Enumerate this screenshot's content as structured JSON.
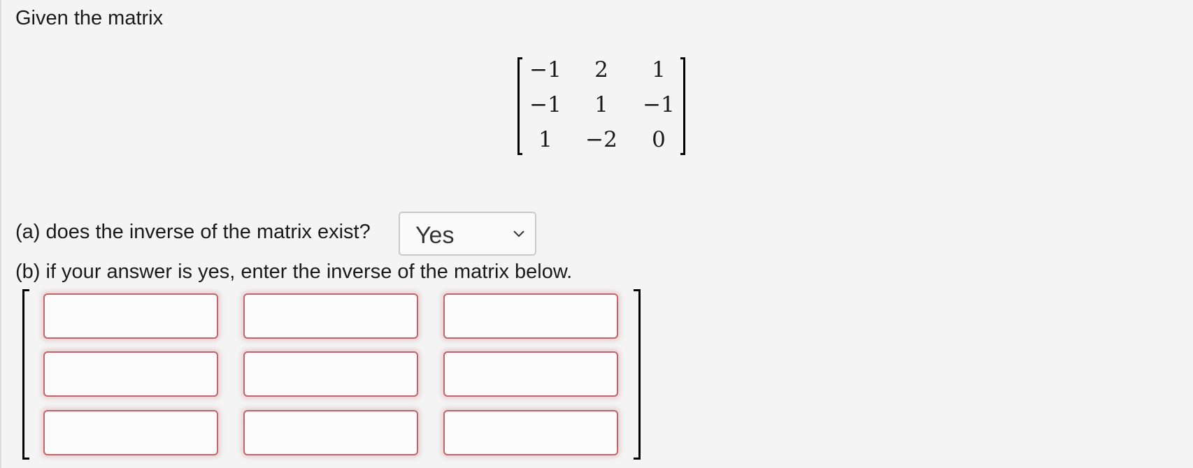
{
  "prompt": {
    "intro": "Given the matrix"
  },
  "given_matrix": {
    "rows": [
      [
        "−1",
        "2",
        "1"
      ],
      [
        "−1",
        "1",
        "−1"
      ],
      [
        "1",
        "−2",
        "0"
      ]
    ]
  },
  "question_a": {
    "text": "(a) does the inverse of the matrix exist?",
    "selected_option": "Yes",
    "dropdown_icon": "chevron-down-icon"
  },
  "question_b": {
    "text": "(b) if your answer is yes, enter the inverse of the matrix below."
  },
  "answer_matrix": {
    "values": [
      [
        "",
        "",
        ""
      ],
      [
        "",
        "",
        ""
      ],
      [
        "",
        "",
        ""
      ]
    ]
  },
  "colors": {
    "background": "#f4f4f4",
    "input_border": "#c0666a"
  }
}
